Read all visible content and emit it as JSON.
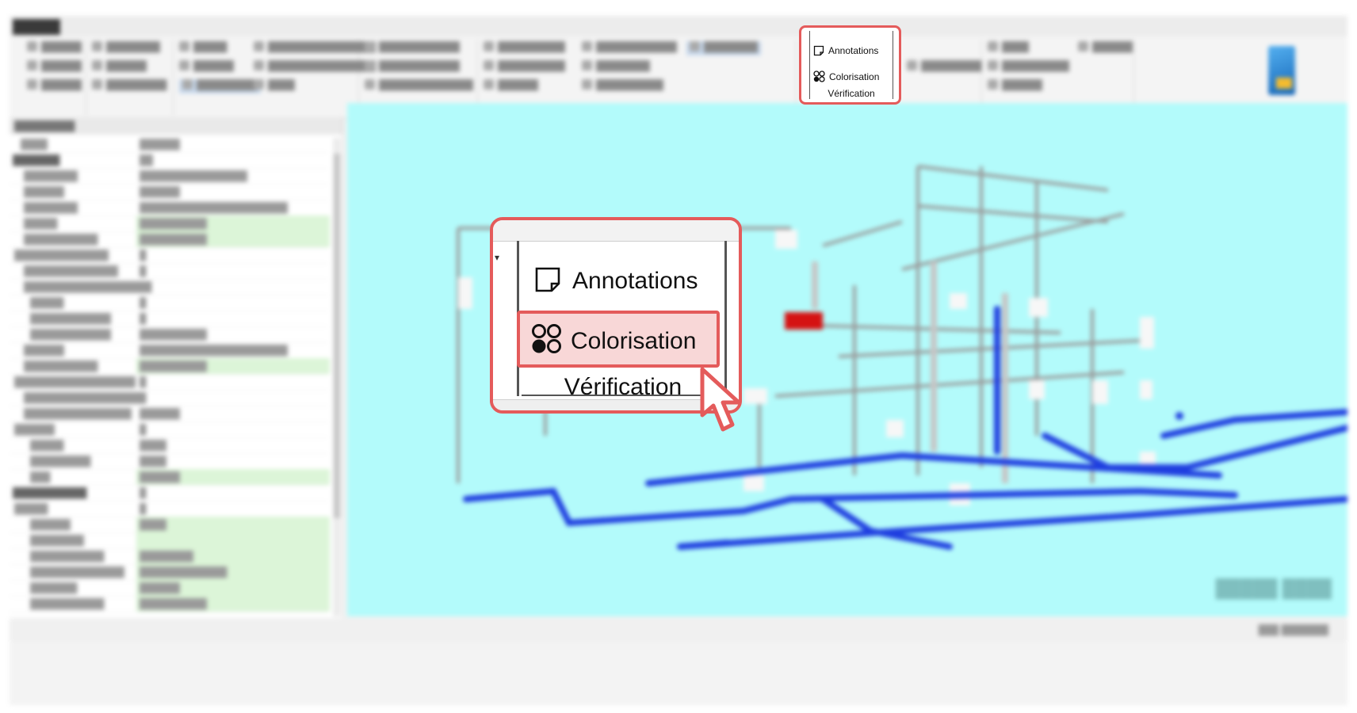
{
  "ribbon_highlight": {
    "annotations_label": "Annotations",
    "colorisation_label": "Colorisation",
    "group_label": "Vérification"
  },
  "zoom_callout": {
    "annotations_label": "Annotations",
    "colorisation_label": "Colorisation",
    "group_label": "Vérification",
    "dropdown_glyph": "▾"
  },
  "icons": {
    "annotations": "sticky-note-icon",
    "colorisation": "color-dots-icon",
    "cursor": "hand-pointer-cursor",
    "dropdown": "chevron-down-icon"
  },
  "colors": {
    "highlight": "#e45b5b",
    "highlight_fill": "#f8d7d7",
    "viewport_background": "#b3fbfb",
    "pipe_blue": "#1f3ee0"
  }
}
